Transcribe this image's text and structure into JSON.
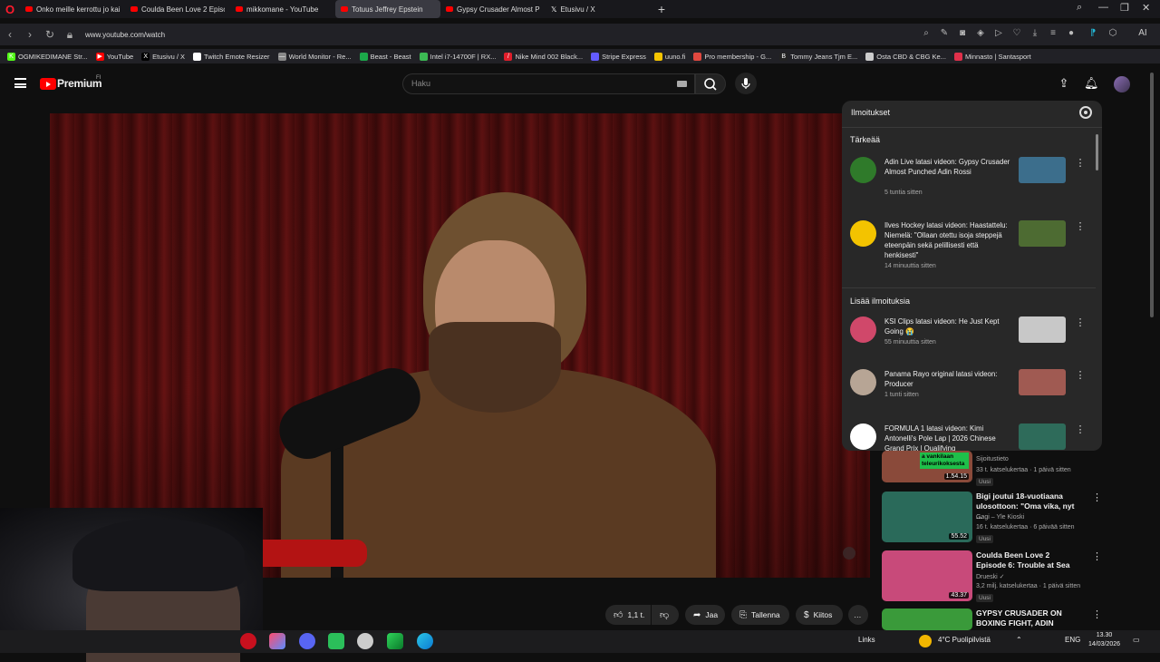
{
  "browser": {
    "tabs": [
      {
        "title": "Onko meille kerrottu jo kaik",
        "icon": "youtube",
        "active": false
      },
      {
        "title": "Coulda Been Love 2 Episo",
        "icon": "youtube",
        "active": false
      },
      {
        "title": "mikkomane - YouTube",
        "icon": "youtube",
        "active": false
      },
      {
        "title": "Totuus Jeffrey Epstein",
        "icon": "youtube",
        "active": true
      },
      {
        "title": "Gypsy Crusader Almost P",
        "icon": "youtube",
        "active": false
      },
      {
        "title": "Etusivu / X",
        "icon": "x",
        "active": false
      }
    ],
    "new_tab": "+",
    "url": "www.youtube.com/watch",
    "ai_label": "AI",
    "bookmarks": [
      {
        "label": "OGMIKEDIMANE Str...",
        "color": "#53fc18",
        "glyph": "K"
      },
      {
        "label": "YouTube",
        "color": "#ff0000",
        "glyph": "▶"
      },
      {
        "label": "Etusivu / X",
        "color": "#000000",
        "glyph": "X"
      },
      {
        "label": "Twitch Emote Resizer",
        "color": "#ffffff",
        "glyph": ""
      },
      {
        "label": "World Monitor - Re...",
        "color": "#888888",
        "glyph": "—"
      },
      {
        "label": "Beast - Beast",
        "color": "#1ca84a",
        "glyph": ""
      },
      {
        "label": "Intel i7-14700F | RX...",
        "color": "#3cba54",
        "glyph": ""
      },
      {
        "label": "Nike Mind 002 Black...",
        "color": "#e01e2b",
        "glyph": "/"
      },
      {
        "label": "Stripe Express",
        "color": "#635bff",
        "glyph": ""
      },
      {
        "label": "uuno.fi",
        "color": "#f5c400",
        "glyph": ""
      },
      {
        "label": "Pro membership - G...",
        "color": "#e0483f",
        "glyph": ""
      },
      {
        "label": "Tommy Jeans Tjm E...",
        "color": "#222222",
        "glyph": "B"
      },
      {
        "label": "Osta CBD & CBG Ke...",
        "color": "#cccccc",
        "glyph": ""
      },
      {
        "label": "Minnasto | Santasport",
        "color": "#e0304a",
        "glyph": ""
      }
    ]
  },
  "youtube": {
    "logo_text": "Premium",
    "region": "FI",
    "search_placeholder": "Haku",
    "notifications": {
      "title": "Ilmoitukset",
      "important_heading": "Tärkeää",
      "more_heading": "Lisää ilmoituksia",
      "important": [
        {
          "text": "Adin Live latasi videon: Gypsy Crusader Almost Punched Adin Rossi",
          "time": "5 tuntia sitten",
          "avatar_color": "#2f7a2a",
          "thumb_color": "#3c6e8c"
        },
        {
          "text": "Ilves Hockey latasi videon: Haastattelu: Niemelä: \"Ollaan otettu isoja steppejä eteenpäin sekä pelillisesti että henkisesti\"",
          "time": "14 minuuttia sitten",
          "avatar_color": "#f3c300",
          "thumb_color": "#4d6b32"
        }
      ],
      "more": [
        {
          "text": "KSI Clips latasi videon: He Just Kept Going 😭",
          "time": "55 minuuttia sitten",
          "avatar_color": "#d0486a",
          "thumb_color": "#c8c8c8"
        },
        {
          "text": "Panama Rayo original latasi videon: Producer",
          "time": "1 tunti sitten",
          "avatar_color": "#b7a595",
          "thumb_color": "#a05a52"
        },
        {
          "text": "FORMULA 1 latasi videon: Kimi Antonelli's Pole Lap | 2026 Chinese Grand Prix | Qualifying",
          "time": "",
          "avatar_color": "#ffffff",
          "thumb_color": "#2e6b5a"
        }
      ]
    },
    "recommendations": [
      {
        "title": "",
        "channel": "Sijoitustieto",
        "meta": "33 t. katselukertaa · 1 päivä sitten",
        "badge": "Uusi",
        "duration": "1.54.15",
        "overlay": "a vankilaan teleurikoksesta",
        "thumb_color": "#8a4a3a"
      },
      {
        "title": "Bigi joutui 18-vuotiaana ulosottoon: \"Oma vika, nyt ...",
        "channel": "Gagi – Yle Kioski",
        "meta": "16 t. katselukertaa · 6 päivää sitten",
        "badge": "Uusi",
        "duration": "55.52",
        "overlay": "",
        "thumb_color": "#2a6a5a"
      },
      {
        "title": "Coulda Been Love 2 Episode 6: Trouble at Sea",
        "channel": "Drueski ✓",
        "meta": "3,2 milj. katselukertaa · 1 päivä sitten",
        "badge": "Uusi",
        "duration": "43.37",
        "overlay": "",
        "thumb_color": "#c84a7a"
      },
      {
        "title": "GYPSY CRUSADER ON BOXING FIGHT, ADIN ROSS BEEF ...",
        "channel": "",
        "meta": "",
        "badge": "",
        "duration": "",
        "overlay": "",
        "thumb_color": "#3a9a3a"
      }
    ],
    "actions": {
      "likes": "1,1 t.",
      "share": "Jaa",
      "save": "Tallenna",
      "thanks": "Kiitos",
      "more": "…"
    }
  },
  "taskbar": {
    "links_label": "Links",
    "weather": "4°C  Puolipilvistä",
    "language": "ENG",
    "time": "13.30",
    "date": "14/03/2026"
  }
}
